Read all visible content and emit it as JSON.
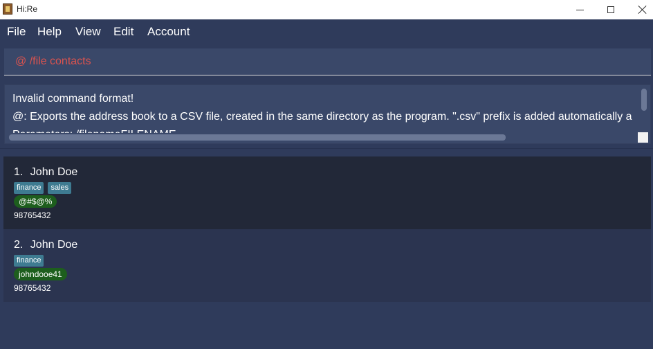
{
  "window": {
    "title": "Hi:Re",
    "app_icon": "hire-app-icon",
    "controls": [
      "minimize-icon",
      "maximize-icon",
      "close-icon"
    ]
  },
  "menu": {
    "items": [
      "File",
      "Help",
      "View",
      "Edit",
      "Account"
    ]
  },
  "command": {
    "value": "@ /file contacts",
    "color": "#d9534f"
  },
  "result": {
    "lines": [
      "Invalid command format!",
      "@: Exports the address book to a CSV file, created in the same directory as the program. \".csv\" prefix is added automatically a",
      "Parameters: /filenameFILENAME"
    ]
  },
  "contacts": [
    {
      "index": "1.",
      "name": "John Doe",
      "tags": [
        "finance",
        "sales"
      ],
      "handle": "@#$@%",
      "phone": "98765432"
    },
    {
      "index": "2.",
      "name": "John Doe",
      "tags": [
        "finance"
      ],
      "handle": "johndooe41",
      "phone": "98765432"
    }
  ],
  "colors": {
    "background": "#2f3b5b",
    "tag": "#3e7b91",
    "handle": "#1d5e1d",
    "card_selected": "#222838",
    "card": "#2b3450"
  }
}
